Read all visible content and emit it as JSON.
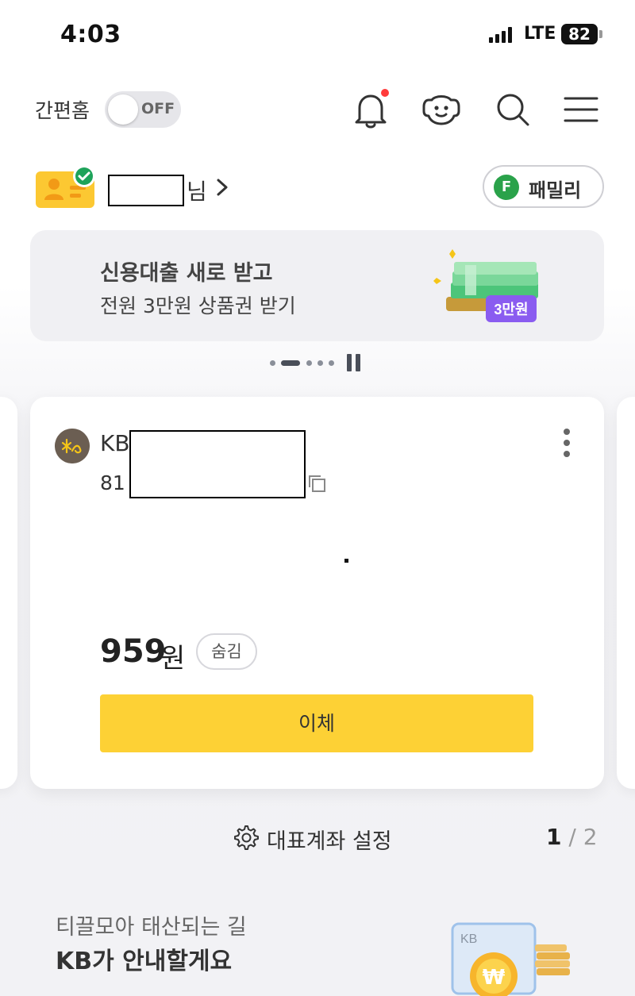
{
  "status_bar": {
    "time": "4:03",
    "network": "LTE",
    "battery": "82"
  },
  "header": {
    "simple_home_label": "간편홈",
    "toggle_state": "OFF",
    "icons": [
      "bell-icon",
      "chatbot-icon",
      "search-icon",
      "menu-icon"
    ],
    "has_notification": true
  },
  "profile": {
    "name_suffix": "님",
    "family_label": "패밀리",
    "family_badge": "F"
  },
  "banner": {
    "title": "신용대출 새로 받고",
    "subtitle": "전원 3만원 상품권 받기",
    "badge": "3만원",
    "page_count": 5,
    "active_page": 2
  },
  "account_card": {
    "bank_prefix": "KB",
    "account_prefix": "81",
    "balance": "959",
    "balance_unit": "원",
    "hide_label": "숨김",
    "transfer_label": "이체"
  },
  "footer": {
    "rep_account_label": "대표계좌 설정",
    "pager_current": "1",
    "pager_sep": " / ",
    "pager_total": "2"
  },
  "promo": {
    "subtitle": "티끌모아 태산되는 길",
    "title": "KB가 안내할게요",
    "art_label": "KB"
  },
  "colors": {
    "accent_yellow": "#fdd135",
    "family_green": "#2aa24a",
    "badge_purple": "#8a5cf0",
    "notification_red": "#ff3b3b"
  }
}
